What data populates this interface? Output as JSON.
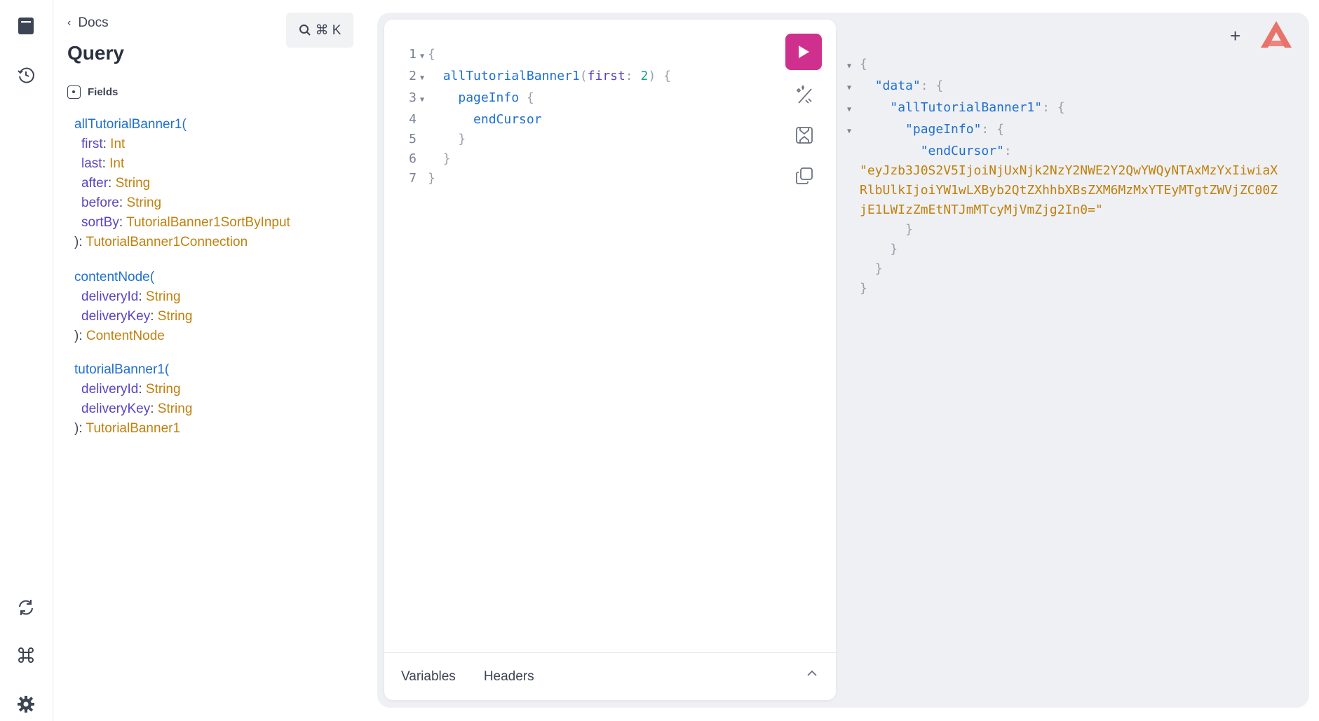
{
  "rail": {
    "icons": [
      "docs-icon",
      "history-icon",
      "refresh-icon",
      "command-icon",
      "settings-icon"
    ]
  },
  "docs": {
    "back_label": "Docs",
    "title": "Query",
    "search_label": "⌘ K",
    "fields_label": "Fields",
    "fields": [
      {
        "name": "allTutorialBanner1(",
        "args": [
          {
            "name": "first",
            "type": "Int"
          },
          {
            "name": "last",
            "type": "Int"
          },
          {
            "name": "after",
            "type": "String"
          },
          {
            "name": "before",
            "type": "String"
          },
          {
            "name": "sortBy",
            "type": "TutorialBanner1SortByInput"
          }
        ],
        "close": "):",
        "return_type": "TutorialBanner1Connection"
      },
      {
        "name": "contentNode(",
        "args": [
          {
            "name": "deliveryId",
            "type": "String"
          },
          {
            "name": "deliveryKey",
            "type": "String"
          }
        ],
        "close": "):",
        "return_type": "ContentNode"
      },
      {
        "name": "tutorialBanner1(",
        "args": [
          {
            "name": "deliveryId",
            "type": "String"
          },
          {
            "name": "deliveryKey",
            "type": "String"
          }
        ],
        "close": "):",
        "return_type": "TutorialBanner1"
      }
    ]
  },
  "editor": {
    "lines": [
      {
        "n": "1",
        "fold": true,
        "text": "{"
      },
      {
        "n": "2",
        "fold": true,
        "text": "allTutorialBanner1(first: 2) {"
      },
      {
        "n": "3",
        "fold": true,
        "text": "pageInfo {"
      },
      {
        "n": "4",
        "fold": false,
        "text": "endCursor"
      },
      {
        "n": "5",
        "fold": false,
        "text": "}"
      },
      {
        "n": "6",
        "fold": false,
        "text": "}"
      },
      {
        "n": "7",
        "fold": false,
        "text": "}"
      }
    ],
    "query_name": "allTutorialBanner1",
    "arg_name": "first",
    "arg_value": "2",
    "page_info": "pageInfo",
    "end_cursor": "endCursor",
    "tabs": [
      "Variables",
      "Headers"
    ]
  },
  "result": {
    "key_data": "\"data\"",
    "key_all": "\"allTutorialBanner1\"",
    "key_pageinfo": "\"pageInfo\"",
    "key_endcursor": "\"endCursor\"",
    "cursor_lines": [
      "\"eyJzb3J0S2V5IjoiNjUxNjk2NzY2NWE2Y2QwYWQyNTAxMzYxIiwiaX",
      "RlbUlkIjoiYW1wLXByb2QtZXhhbXBsZXM6MzMxYTEyMTgtZWVjZC00Z",
      "jE1LWIzZmEtNTJmMTcyMjVmZjg2In0=\""
    ]
  },
  "colors": {
    "accent": "#d0308d",
    "field": "#1f6fd1",
    "arg": "#5a44c2",
    "type": "#c0800d",
    "logo": "#e8736b"
  }
}
